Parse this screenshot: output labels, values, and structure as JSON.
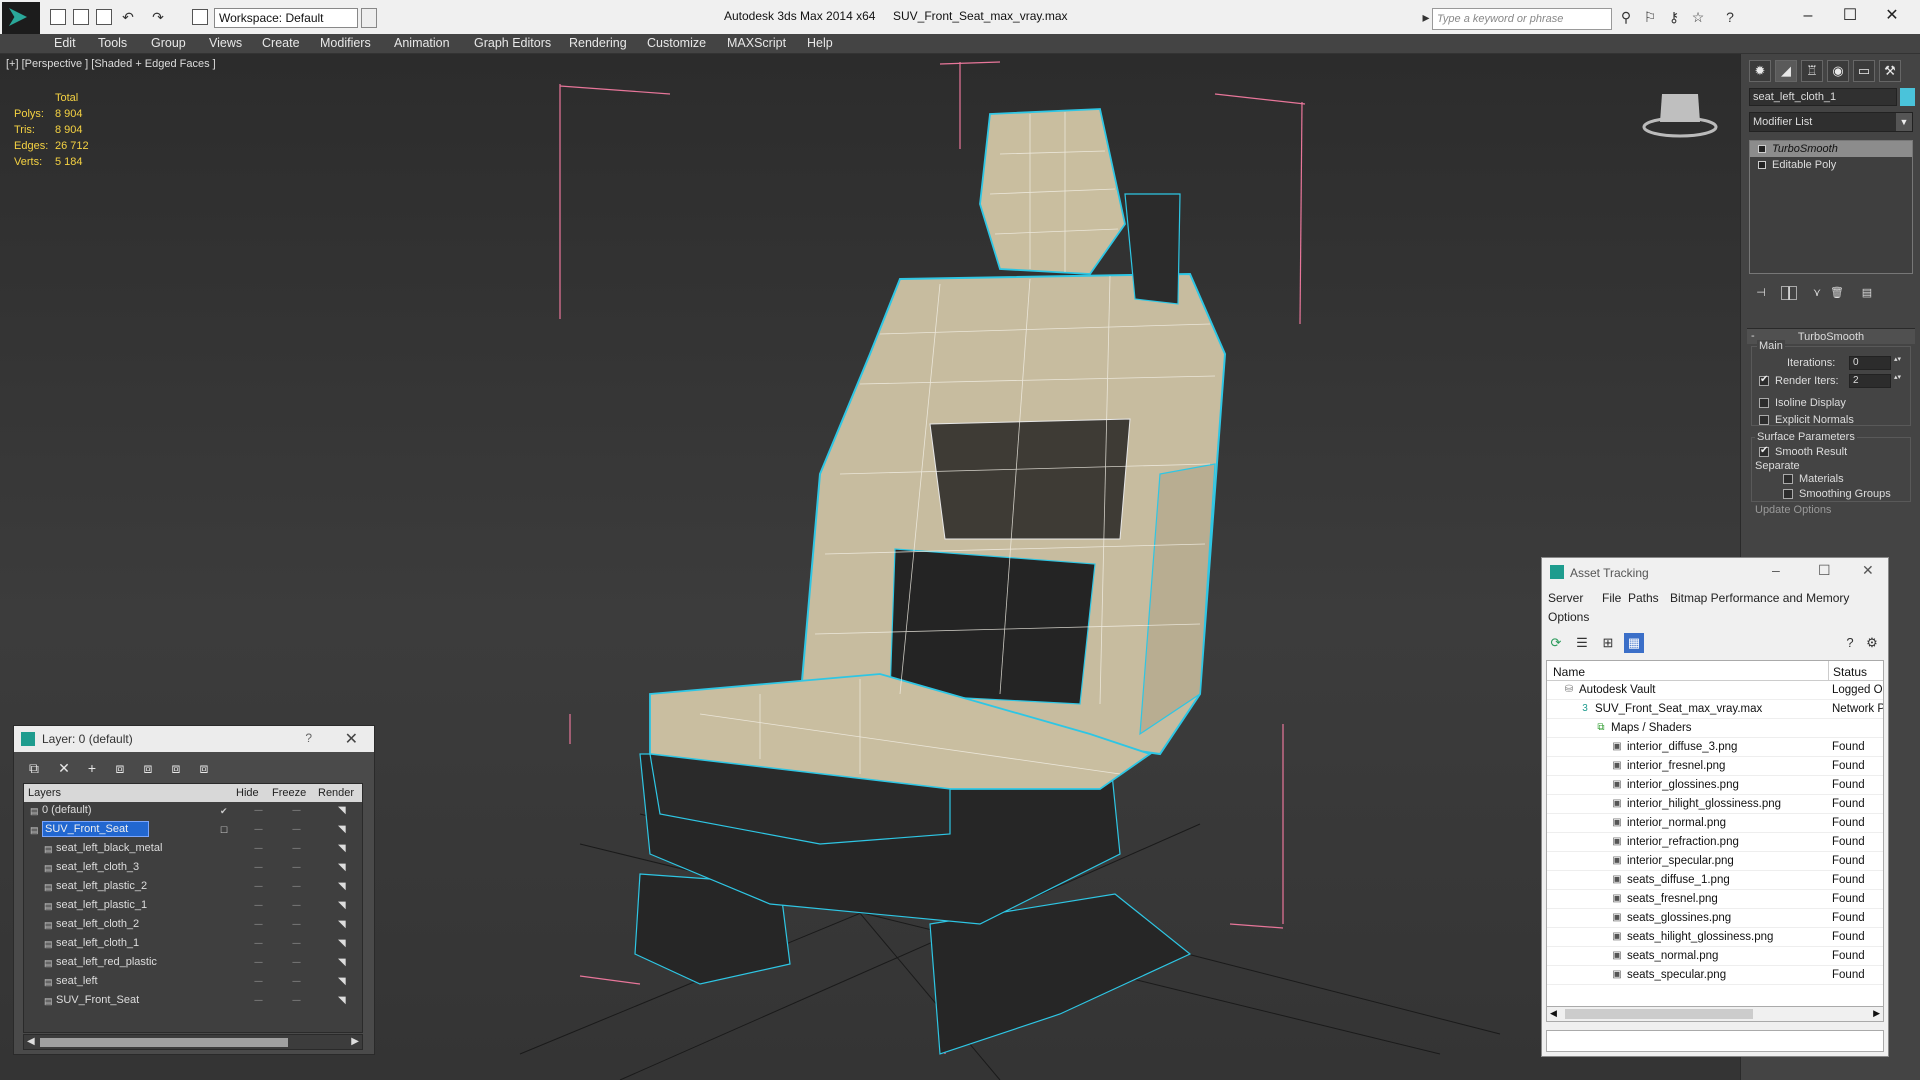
{
  "titlebar": {
    "workspace": "Workspace: Default",
    "app_title": "Autodesk 3ds Max  2014 x64",
    "file_title": "SUV_Front_Seat_max_vray.max",
    "search_placeholder": "Type a keyword or phrase",
    "help": "?"
  },
  "menu": [
    "Edit",
    "Tools",
    "Group",
    "Views",
    "Create",
    "Modifiers",
    "Animation",
    "Graph Editors",
    "Rendering",
    "Customize",
    "MAXScript",
    "Help"
  ],
  "viewport": {
    "label": "[+] [Perspective ] [Shaded + Edged Faces ]",
    "stats": {
      "header": "Total",
      "rows": [
        {
          "k": "Polys:",
          "v": "8 904"
        },
        {
          "k": "Tris:",
          "v": "8 904"
        },
        {
          "k": "Edges:",
          "v": "26 712"
        },
        {
          "k": "Verts:",
          "v": "5 184"
        }
      ]
    },
    "colors": {
      "wire": "#2ec6e4",
      "bbox": "#e8769a",
      "cloth": "#cfc3a5",
      "dark": "#2b2b2b"
    }
  },
  "command_panel": {
    "object_name": "seat_left_cloth_1",
    "object_color": "#4ac3da",
    "modifier_list": "Modifier List",
    "stack": [
      "TurboSmooth",
      "Editable Poly"
    ],
    "rollout_title": "TurboSmooth",
    "main_label": "Main",
    "iterations_label": "Iterations:",
    "iterations_value": "0",
    "render_iters_label": "Render Iters:",
    "render_iters_value": "2",
    "render_iters_checked": true,
    "isoline": "Isoline Display",
    "explicit_normals": "Explicit Normals",
    "surface_params": "Surface Parameters",
    "smooth_result": "Smooth Result",
    "separate": "Separate",
    "materials": "Materials",
    "smoothing_groups": "Smoothing Groups",
    "update_options": "Update Options"
  },
  "layer_panel": {
    "title": "Layer: 0 (default)",
    "help": "?",
    "headers": {
      "layers": "Layers",
      "hide": "Hide",
      "freeze": "Freeze",
      "render": "Render"
    },
    "rows": [
      {
        "name": "0 (default)",
        "level": 0,
        "selected": false
      },
      {
        "name": "SUV_Front_Seat",
        "level": 0,
        "selected": true
      },
      {
        "name": "seat_left_black_metal",
        "level": 1,
        "selected": false
      },
      {
        "name": "seat_left_cloth_3",
        "level": 1,
        "selected": false
      },
      {
        "name": "seat_left_plastic_2",
        "level": 1,
        "selected": false
      },
      {
        "name": "seat_left_plastic_1",
        "level": 1,
        "selected": false
      },
      {
        "name": "seat_left_cloth_2",
        "level": 1,
        "selected": false
      },
      {
        "name": "seat_left_cloth_1",
        "level": 1,
        "selected": false
      },
      {
        "name": "seat_left_red_plastic",
        "level": 1,
        "selected": false
      },
      {
        "name": "seat_left",
        "level": 1,
        "selected": false
      },
      {
        "name": "SUV_Front_Seat",
        "level": 1,
        "selected": false
      }
    ]
  },
  "asset_tracking": {
    "title": "Asset Tracking",
    "menu": [
      "Server",
      "File",
      "Paths",
      "Bitmap Performance and Memory",
      "Options"
    ],
    "headers": {
      "name": "Name",
      "status": "Status"
    },
    "rows": [
      {
        "name": "Autodesk Vault",
        "status": "Logged Ou",
        "level": 0,
        "icon": "vault"
      },
      {
        "name": "SUV_Front_Seat_max_vray.max",
        "status": "Network P",
        "level": 1,
        "icon": "max"
      },
      {
        "name": "Maps / Shaders",
        "status": "",
        "level": 2,
        "icon": "maps"
      },
      {
        "name": "interior_diffuse_3.png",
        "status": "Found",
        "level": 3,
        "icon": "file"
      },
      {
        "name": "interior_fresnel.png",
        "status": "Found",
        "level": 3,
        "icon": "file"
      },
      {
        "name": "interior_glossines.png",
        "status": "Found",
        "level": 3,
        "icon": "file"
      },
      {
        "name": "interior_hilight_glossiness.png",
        "status": "Found",
        "level": 3,
        "icon": "file"
      },
      {
        "name": "interior_normal.png",
        "status": "Found",
        "level": 3,
        "icon": "file"
      },
      {
        "name": "interior_refraction.png",
        "status": "Found",
        "level": 3,
        "icon": "file"
      },
      {
        "name": "interior_specular.png",
        "status": "Found",
        "level": 3,
        "icon": "file"
      },
      {
        "name": "seats_diffuse_1.png",
        "status": "Found",
        "level": 3,
        "icon": "file"
      },
      {
        "name": "seats_fresnel.png",
        "status": "Found",
        "level": 3,
        "icon": "file"
      },
      {
        "name": "seats_glossines.png",
        "status": "Found",
        "level": 3,
        "icon": "file"
      },
      {
        "name": "seats_hilight_glossiness.png",
        "status": "Found",
        "level": 3,
        "icon": "file"
      },
      {
        "name": "seats_normal.png",
        "status": "Found",
        "level": 3,
        "icon": "file"
      },
      {
        "name": "seats_specular.png",
        "status": "Found",
        "level": 3,
        "icon": "file"
      }
    ]
  }
}
